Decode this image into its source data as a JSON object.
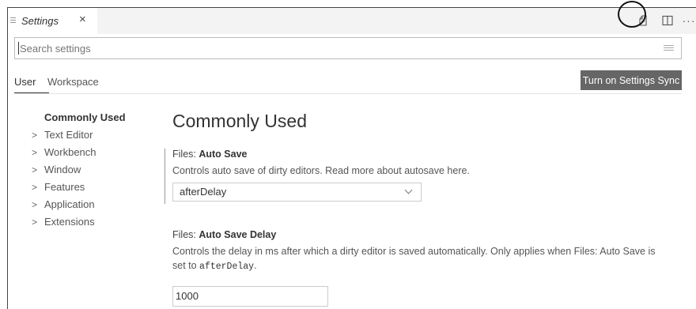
{
  "tab": {
    "title": "Settings",
    "close": "×"
  },
  "toolbar": {
    "more": "···"
  },
  "search": {
    "placeholder": "Search settings"
  },
  "scope_tabs": {
    "user": "User",
    "workspace": "Workspace"
  },
  "sync_button": "Turn on Settings Sync",
  "toc": {
    "items": [
      {
        "label": "Commonly Used"
      },
      {
        "label": "Text Editor"
      },
      {
        "label": "Workbench"
      },
      {
        "label": "Window"
      },
      {
        "label": "Features"
      },
      {
        "label": "Application"
      },
      {
        "label": "Extensions"
      }
    ]
  },
  "section_title": "Commonly Used",
  "settings": {
    "auto_save": {
      "category": "Files: ",
      "name": "Auto Save",
      "description": "Controls auto save of dirty editors. Read more about autosave here.",
      "value": "afterDelay"
    },
    "auto_save_delay": {
      "category": "Files: ",
      "name": "Auto Save Delay",
      "description_before": "Controls the delay in ms after which a dirty editor is saved automatically. Only applies when Files: Auto Save is set to ",
      "description_code": "afterDelay",
      "description_after": ".",
      "value": "1000"
    }
  },
  "icons": {
    "editor_tab": "menu-lines-icon",
    "sync": "settings-sync-icon",
    "split": "split-editor-icon",
    "filter": "clear-filter-icon",
    "chevron": "chevron-right-icon",
    "dropdown": "chevron-down-icon"
  }
}
